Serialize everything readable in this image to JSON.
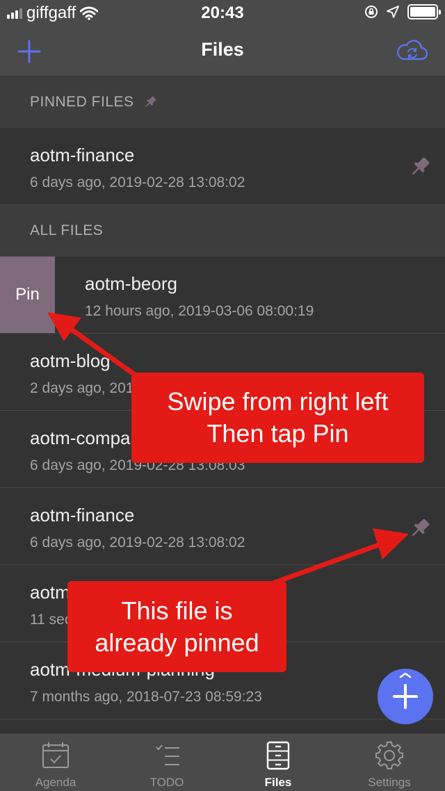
{
  "status_bar": {
    "carrier": "giffgaff",
    "time": "20:43"
  },
  "nav": {
    "title": "Files",
    "add_icon": "plus-icon",
    "sync_icon": "cloud-sync-icon"
  },
  "pinned_section": {
    "header": "PINNED FILES",
    "files": [
      {
        "name": "aotm-finance",
        "meta": "6 days ago, 2019-02-28 13:08:02",
        "pinned": true
      }
    ]
  },
  "all_section": {
    "header": "ALL FILES",
    "files": [
      {
        "name": "aotm-beorg",
        "meta": "12 hours ago, 2019-03-06 08:00:19",
        "pinned": false,
        "swipe_action": "Pin"
      },
      {
        "name": "aotm-blog",
        "meta": "2 days ago, 2019-03-04 22:44:46",
        "pinned": false
      },
      {
        "name": "aotm-company",
        "meta": "6 days ago, 2019-02-28 13:08:03",
        "pinned": false
      },
      {
        "name": "aotm-finance",
        "meta": "6 days ago, 2019-02-28 13:08:02",
        "pinned": true
      },
      {
        "name": "aotm-gocalc",
        "meta": "11 seconds ago, 2019-03-06 20:43:18",
        "pinned": false
      },
      {
        "name": "aotm-medium-planning",
        "meta": "7 months ago, 2018-07-23 08:59:23",
        "pinned": false
      }
    ]
  },
  "annotations": {
    "swipe_line1": "Swipe from right left",
    "swipe_line2": "Then tap Pin",
    "pinned_line1": "This file is",
    "pinned_line2": "already pinned"
  },
  "tabs": [
    {
      "label": "Agenda",
      "icon": "calendar-icon",
      "active": false
    },
    {
      "label": "TODO",
      "icon": "checklist-icon",
      "active": false
    },
    {
      "label": "Files",
      "icon": "file-cabinet-icon",
      "active": true
    },
    {
      "label": "Settings",
      "icon": "gear-icon",
      "active": false
    }
  ],
  "colors": {
    "accent": "#5b73f0",
    "pin": "#7f6a7b",
    "callout": "#e41a16"
  }
}
